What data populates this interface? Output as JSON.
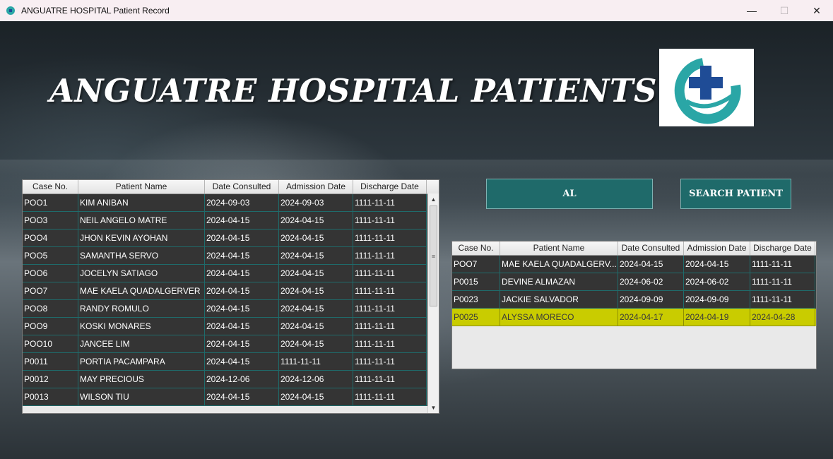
{
  "window": {
    "title": "ANGUATRE HOSPITAL Patient Record",
    "controls": {
      "minimize": "—",
      "maximize": "☐",
      "close": "✕"
    }
  },
  "header": {
    "title": "ANGUATRE HOSPITAL PATIENTS"
  },
  "colors": {
    "teal": "#1f6a6a",
    "selected_row": "#c9cc00",
    "row_bg": "#343434",
    "logo_teal": "#2aa6a6",
    "logo_blue": "#1f4c96"
  },
  "table_columns": [
    "Case No.",
    "Patient Name",
    "Date Consulted",
    "Admission Date",
    "Discharge Date"
  ],
  "all_patients": [
    [
      "POO1",
      "KIM ANIBAN",
      "2024-09-03",
      "2024-09-03",
      "1111-11-11"
    ],
    [
      "POO3",
      "NEIL ANGELO MATRE",
      "2024-04-15",
      "2024-04-15",
      "1111-11-11"
    ],
    [
      "POO4",
      "JHON KEVIN AYOHAN",
      "2024-04-15",
      "2024-04-15",
      "1111-11-11"
    ],
    [
      "POO5",
      "SAMANTHA SERVO",
      "2024-04-15",
      "2024-04-15",
      "1111-11-11"
    ],
    [
      "POO6",
      "JOCELYN SATIAGO",
      "2024-04-15",
      "2024-04-15",
      "1111-11-11"
    ],
    [
      "POO7",
      "MAE KAELA QUADALGERVER",
      "2024-04-15",
      "2024-04-15",
      "1111-11-11"
    ],
    [
      "POO8",
      "RANDY ROMULO",
      "2024-04-15",
      "2024-04-15",
      "1111-11-11"
    ],
    [
      "POO9",
      "KOSKI MONARES",
      "2024-04-15",
      "2024-04-15",
      "1111-11-11"
    ],
    [
      "POO10",
      "JANCEE LIM",
      "2024-04-15",
      "2024-04-15",
      "1111-11-11"
    ],
    [
      "P0011",
      "PORTIA PACAMPARA",
      "2024-04-15",
      "1111-11-11",
      "1111-11-11"
    ],
    [
      "P0012",
      "MAY PRECIOUS",
      "2024-12-06",
      "2024-12-06",
      "1111-11-11"
    ],
    [
      "P0013",
      "WILSON TIU",
      "2024-04-15",
      "2024-04-15",
      "1111-11-11"
    ]
  ],
  "search": {
    "value": "AL",
    "button_label": "SEARCH PATIENT"
  },
  "search_results": [
    [
      "POO7",
      "MAE KAELA QUADALGERV...",
      "2024-04-15",
      "2024-04-15",
      "1111-11-11"
    ],
    [
      "P0015",
      "DEVINE ALMAZAN",
      "2024-06-02",
      "2024-06-02",
      "1111-11-11"
    ],
    [
      "P0023",
      "JACKIE SALVADOR",
      "2024-09-09",
      "2024-09-09",
      "1111-11-11"
    ],
    [
      "P0025",
      "ALYSSA MORECO",
      "2024-04-17",
      "2024-04-19",
      "2024-04-28"
    ]
  ],
  "selected_result_index": 3
}
